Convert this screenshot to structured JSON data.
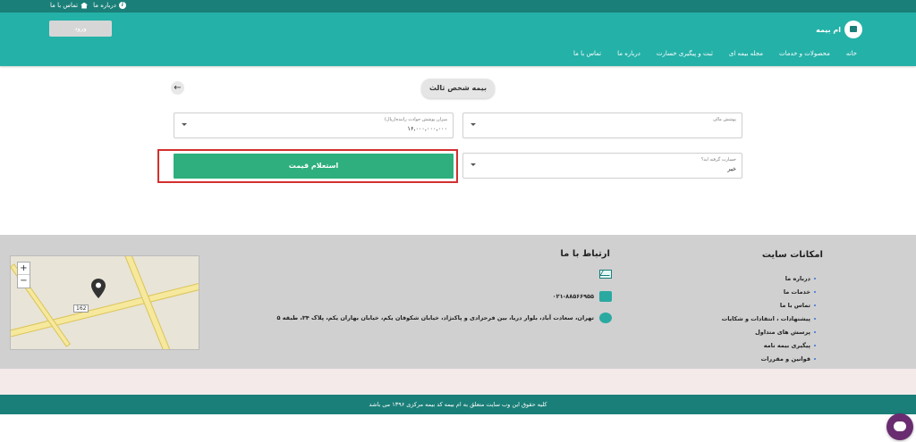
{
  "topbar": {
    "about": "درباره ما",
    "contact": "تماس با ما"
  },
  "header": {
    "login": "ورود",
    "brand": "ام بیمه",
    "nav": [
      "خانه",
      "محصولات و خدمات",
      "مجله بیمه ای",
      "ثبت و پیگیری خسارت",
      "درباره ما",
      "تماس با ما"
    ]
  },
  "form": {
    "title": "بیمه شخص ثالث",
    "coverage_label": "پوشش مالی",
    "coverage_value": "",
    "driver_label": "میزان پوشش حوادث راننده(ریال)",
    "driver_value": "۱۶,۰۰۰,۰۰۰,۰۰۰",
    "claim_label": "خسارت گرفته اید؟",
    "claim_value": "خیر",
    "submit": "استعلام قیمت"
  },
  "footer": {
    "features_title": "امکانات سایت",
    "links": [
      "درباره ما",
      "خدمات ما",
      "تماس با ما",
      "پیشنهادات ، انتقادات و شکایات",
      "پرسش های متداول",
      "پیگیری بیمه نامه",
      "قوانین و مقررات"
    ],
    "contact_title": "ارتباط با ما",
    "phone": "۰۲۱-۸۸۵۶۶۹۵۵",
    "address": "تهران، سعادت آباد، بلوار دریا، بین فرحزادی و پاکنژاد، خیابان شکوفان یکم، خیابان بهاران یکم، پلاک ۳۴، طبقه ۵",
    "map_label": "162"
  },
  "copyright": "کلیه حقوق این وب سایت متعلق به ام بیمه کد بیمه مرکزی ۱۳۹۶ می باشد",
  "colors": {
    "primary": "#24b1a8",
    "dark": "#1a7f78",
    "cta": "#2eaf7d",
    "highlight": "#d32f2f"
  }
}
